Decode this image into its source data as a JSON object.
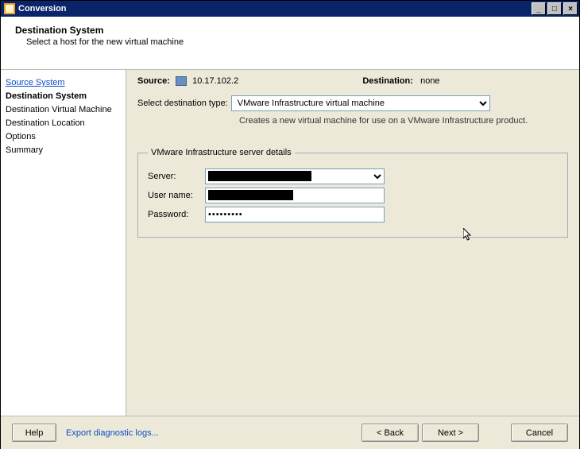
{
  "window": {
    "title": "Conversion",
    "min_icon": "_",
    "max_icon": "□",
    "close_icon": "×"
  },
  "header": {
    "title": "Destination System",
    "subtitle": "Select a host for the new virtual machine"
  },
  "sidebar": {
    "items": [
      {
        "label": "Source System",
        "link": true
      },
      {
        "label": "Destination System",
        "active": true
      },
      {
        "label": "Destination Virtual Machine"
      },
      {
        "label": "Destination Location"
      },
      {
        "label": "Options"
      },
      {
        "label": "Summary"
      }
    ]
  },
  "main": {
    "source_label": "Source:",
    "source_value": "10.17.102.2",
    "destination_label": "Destination:",
    "destination_value": "none",
    "dest_type_label": "Select destination type:",
    "dest_type_value": "VMware Infrastructure virtual machine",
    "dest_type_hint": "Creates a new virtual machine for use on a VMware Infrastructure product.",
    "group_legend": "VMware Infrastructure server details",
    "server_label": "Server:",
    "server_value": "",
    "username_label": "User name:",
    "username_value": "",
    "password_label": "Password:",
    "password_value": "•••••••••"
  },
  "footer": {
    "help": "Help",
    "export_link": "Export diagnostic logs...",
    "back": "< Back",
    "next": "Next >",
    "cancel": "Cancel"
  }
}
